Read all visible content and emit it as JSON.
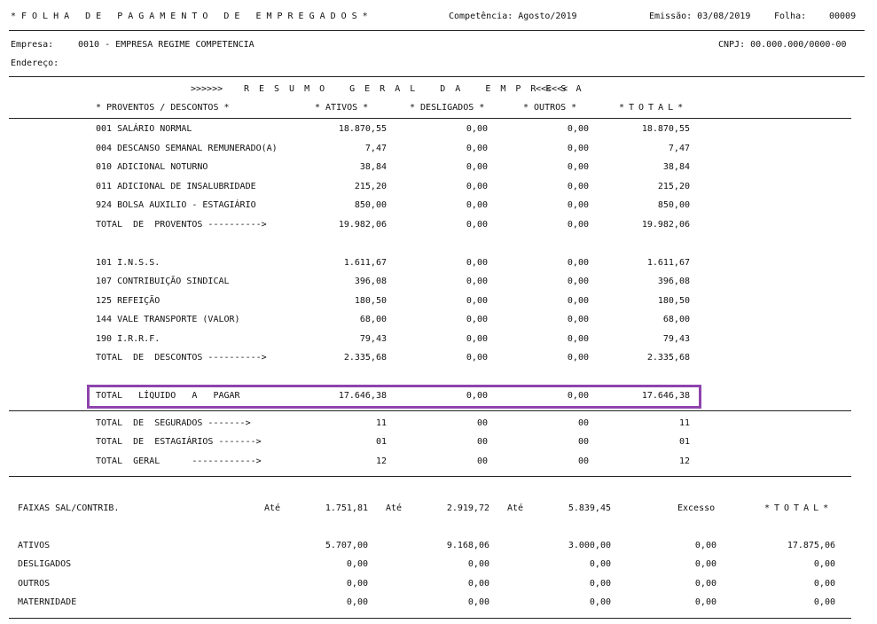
{
  "header": {
    "title": "*FOLHA DE PAGAMENTO DE EMPREGADOS*",
    "competencia": "Competência: Agosto/2019",
    "emissao": "Emissão: 03/08/2019",
    "folha_label": "Folha:",
    "folha_num": "00009"
  },
  "company": {
    "empresa_label": "Empresa:",
    "empresa_value": "0010 - EMPRESA REGIME COMPETENCIA",
    "endereco_label": "Endereço:",
    "cnpj": "CNPJ: 00.000.000/0000-00"
  },
  "resumo": {
    "title_left": ">>>>>>",
    "title": "RESUMO GERAL DA EMPRESA",
    "title_right": "<<<<<<",
    "headers": [
      "* PROVENTOS / DESCONTOS *",
      "* ATIVOS *",
      "* DESLIGADOS *",
      "* OUTROS *",
      "*TOTAL*"
    ],
    "proventos": [
      [
        "001 SALÁRIO NORMAL",
        "18.870,55",
        "0,00",
        "0,00",
        "18.870,55"
      ],
      [
        "004 DESCANSO SEMANAL REMUNERADO(A)",
        "7,47",
        "0,00",
        "0,00",
        "7,47"
      ],
      [
        "010 ADICIONAL NOTURNO",
        "38,84",
        "0,00",
        "0,00",
        "38,84"
      ],
      [
        "011 ADICIONAL DE INSALUBRIDADE",
        "215,20",
        "0,00",
        "0,00",
        "215,20"
      ],
      [
        "924 BOLSA AUXILIO - ESTAGIÁRIO",
        "850,00",
        "0,00",
        "0,00",
        "850,00"
      ],
      [
        "TOTAL  DE  PROVENTOS ---------->",
        "19.982,06",
        "0,00",
        "0,00",
        "19.982,06"
      ]
    ],
    "descontos": [
      [
        "101 I.N.S.S.",
        "1.611,67",
        "0,00",
        "0,00",
        "1.611,67"
      ],
      [
        "107 CONTRIBUIÇÃO SINDICAL",
        "396,08",
        "0,00",
        "0,00",
        "396,08"
      ],
      [
        "125 REFEIÇÃO",
        "180,50",
        "0,00",
        "0,00",
        "180,50"
      ],
      [
        "144 VALE TRANSPORTE (VALOR)",
        "68,00",
        "0,00",
        "0,00",
        "68,00"
      ],
      [
        "190 I.R.R.F.",
        "79,43",
        "0,00",
        "0,00",
        "79,43"
      ],
      [
        "TOTAL  DE  DESCONTOS ---------->",
        "2.335,68",
        "0,00",
        "0,00",
        "2.335,68"
      ]
    ],
    "liquido": [
      "TOTAL   LÍQUIDO   A   PAGAR",
      "17.646,38",
      "0,00",
      "0,00",
      "17.646,38"
    ],
    "counts": [
      [
        "TOTAL  DE  SEGURADOS ------->",
        "11",
        "00",
        "00",
        "11"
      ],
      [
        "TOTAL  DE  ESTAGIÁRIOS ------->",
        "01",
        "00",
        "00",
        "01"
      ],
      [
        "TOTAL  GERAL      ------------>",
        "12",
        "00",
        "00",
        "12"
      ]
    ]
  },
  "faixas": {
    "label": "FAIXAS SAL/CONTRIB.",
    "ate": "Até",
    "f1": "1.751,81",
    "f2": "2.919,72",
    "f3": "5.839,45",
    "excesso": "Excesso",
    "total": "*TOTAL*",
    "rows": [
      [
        "ATIVOS",
        "5.707,00",
        "9.168,06",
        "3.000,00",
        "0,00",
        "17.875,06"
      ],
      [
        "DESLIGADOS",
        "0,00",
        "0,00",
        "0,00",
        "0,00",
        "0,00"
      ],
      [
        "OUTROS",
        "0,00",
        "0,00",
        "0,00",
        "0,00",
        "0,00"
      ],
      [
        "MATERNIDADE",
        "0,00",
        "0,00",
        "0,00",
        "0,00",
        "0,00"
      ]
    ]
  }
}
